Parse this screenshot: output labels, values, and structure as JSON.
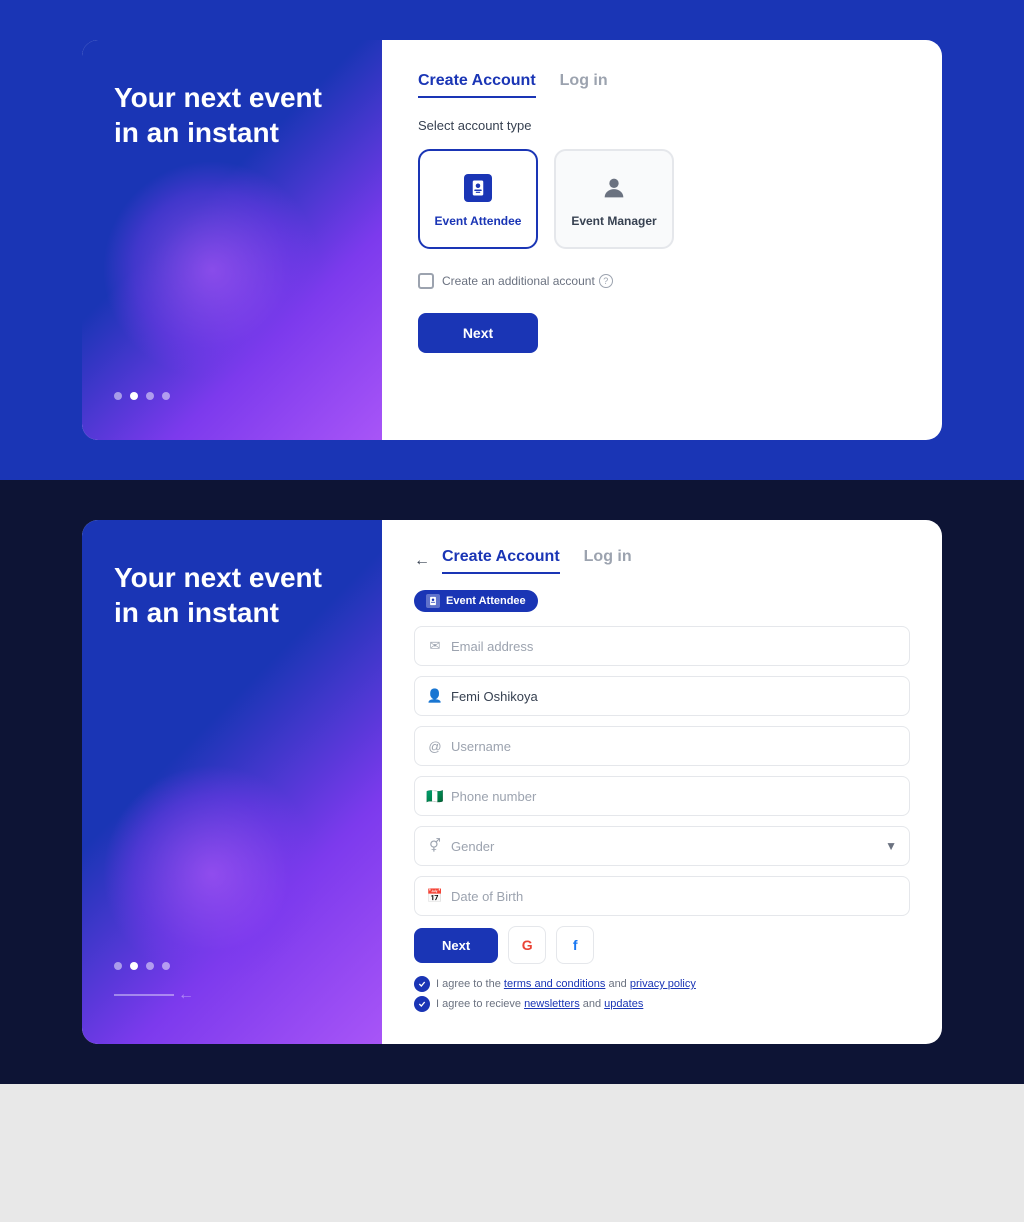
{
  "top": {
    "bg_color": "#1a35b5",
    "left": {
      "title": "Your next event in an instant",
      "dots": [
        false,
        true,
        false,
        false
      ]
    },
    "right": {
      "tabs": [
        {
          "label": "Create Account",
          "active": true
        },
        {
          "label": "Log in",
          "active": false
        }
      ],
      "section_label": "Select account type",
      "account_types": [
        {
          "label": "Event Attendee",
          "selected": true
        },
        {
          "label": "Event Manager",
          "selected": false
        }
      ],
      "checkbox_label": "Create an additional account",
      "next_label": "Next"
    }
  },
  "bottom": {
    "bg_color": "#0d1435",
    "left": {
      "title": "Your next event in an instant",
      "dots": [
        false,
        true,
        false,
        false
      ],
      "back_arrow": "←"
    },
    "right": {
      "back_label": "←",
      "tabs": [
        {
          "label": "Create Account",
          "active": true
        },
        {
          "label": "Log in",
          "active": false
        }
      ],
      "badge": "Event Attendee",
      "fields": [
        {
          "placeholder": "Email address",
          "icon": "envelope",
          "value": ""
        },
        {
          "placeholder": "Femi Oshikoya",
          "icon": "person",
          "value": "Femi Oshikoya"
        },
        {
          "placeholder": "Username",
          "icon": "at",
          "value": ""
        },
        {
          "placeholder": "Phone number",
          "icon": "flag-ng",
          "value": ""
        }
      ],
      "gender_placeholder": "Gender",
      "dob_placeholder": "Date of Birth",
      "next_label": "Next",
      "social_google": "G",
      "social_facebook": "f",
      "terms": [
        {
          "text_before": "I agree to the ",
          "link1": "terms and conditions",
          "text_mid": " and ",
          "link2": "privacy policy",
          "text_after": ""
        },
        {
          "text_before": "I agree to recieve ",
          "link1": "newsletters",
          "text_mid": " and ",
          "link2": "updates",
          "text_after": ""
        }
      ]
    }
  }
}
